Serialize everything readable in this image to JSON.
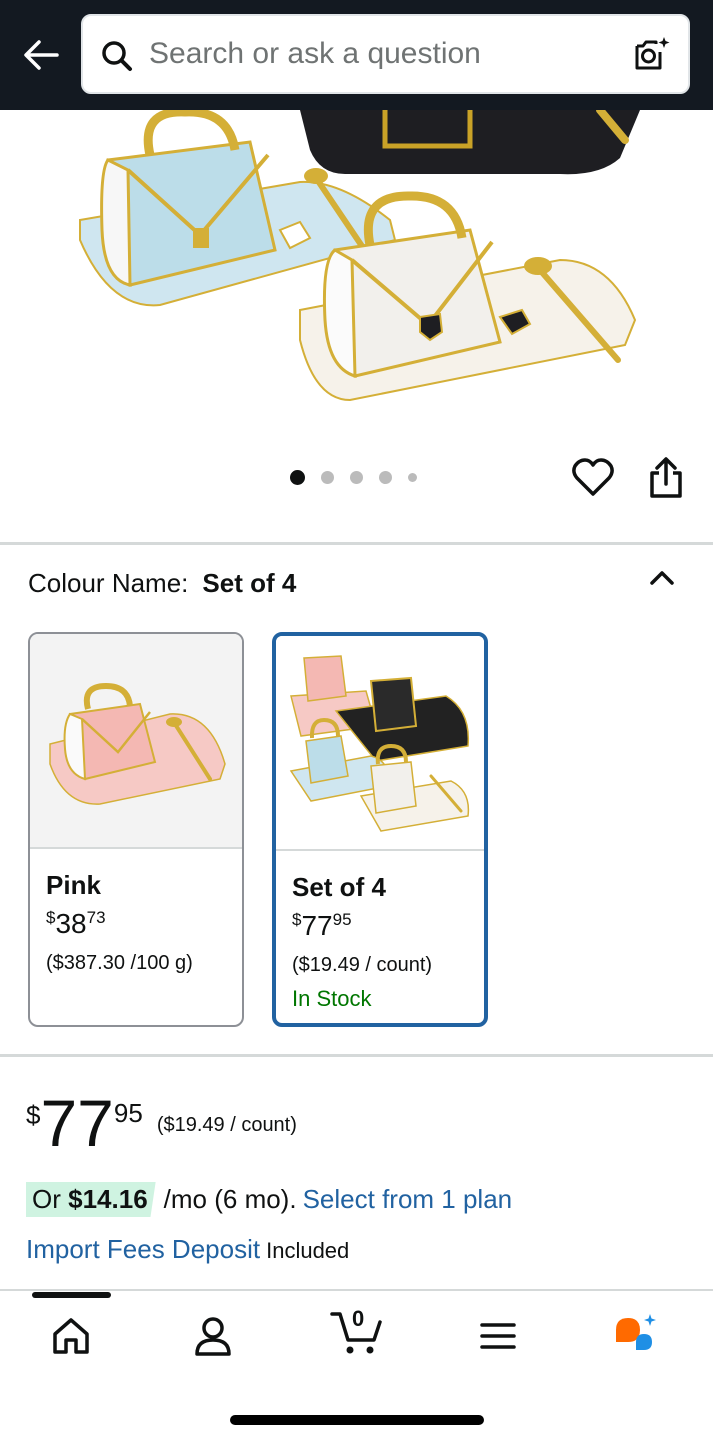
{
  "header": {
    "search_placeholder": "Search or ask a question"
  },
  "gallery": {
    "total_images": 5,
    "active_index": 0
  },
  "variation": {
    "label": "Colour Name:",
    "selected_value": "Set of 4",
    "options": [
      {
        "name": "Pink",
        "price_currency": "$",
        "price_whole": "38",
        "price_fraction": "73",
        "unit_price": "($387.30 /100 g)",
        "stock": ""
      },
      {
        "name": "Set of 4",
        "price_currency": "$",
        "price_whole": "77",
        "price_fraction": "95",
        "unit_price": "($19.49 / count)",
        "stock": "In Stock"
      }
    ]
  },
  "price": {
    "currency": "$",
    "whole": "77",
    "fraction": "95",
    "unit_price": "($19.49 / count)"
  },
  "installment": {
    "prefix": "Or",
    "amount": "$14.16",
    "terms": "/mo (6 mo).",
    "link": "Select from 1 plan"
  },
  "import_fees": {
    "link": "Import Fees Deposit",
    "status": "Included"
  },
  "bottom_nav": {
    "cart_count": "0"
  },
  "colors": {
    "header_bg": "#131921",
    "link": "#2162a1",
    "in_stock": "#007600",
    "selected_border": "#2162a1",
    "installment_highlight": "#cff3e1"
  }
}
